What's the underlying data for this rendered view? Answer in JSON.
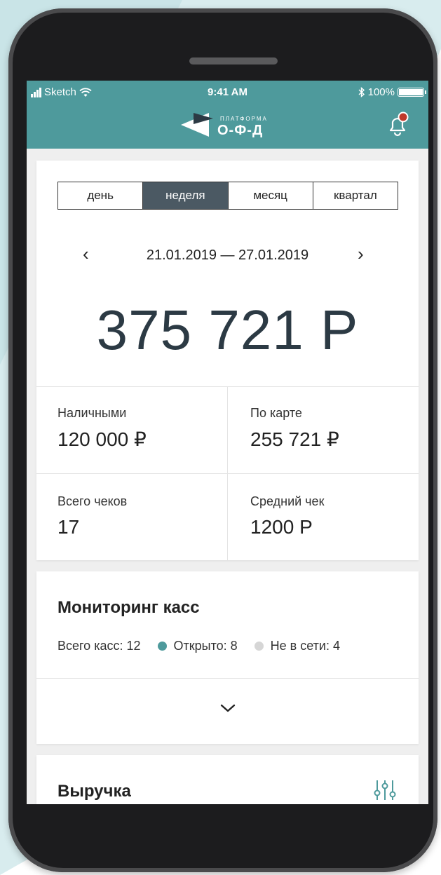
{
  "status_bar": {
    "carrier": "Sketch",
    "time": "9:41 AM",
    "battery": "100%"
  },
  "header": {
    "logo_small": "ПЛАТФОРМА",
    "logo_big": "О-Ф-Д",
    "notification_icon": "bell-icon",
    "notification_dot_color": "#c0392b"
  },
  "periods": {
    "items": [
      "день",
      "неделя",
      "месяц",
      "квартал"
    ],
    "selected": "неделя"
  },
  "date_range": "21.01.2019 — 27.01.2019",
  "total": "375 721 Р",
  "metrics": {
    "cash_label": "Наличными",
    "cash_value": "120 000 ₽",
    "card_label": "По карте",
    "card_value": "255 721 ₽",
    "checks_label": "Всего чеков",
    "checks_value": "17",
    "avg_label": "Средний чек",
    "avg_value": "1200 Р"
  },
  "monitoring": {
    "title": "Мониторинг касс",
    "total": "Всего касс: 12",
    "open": "Открыто: 8",
    "offline": "Не в сети: 4",
    "open_color": "#4e9a9c",
    "offline_color": "#d6d6d6"
  },
  "revenue": {
    "title": "Выручка",
    "filter_icon": "sliders-icon"
  },
  "colors": {
    "header_bg": "#4e9a9c",
    "active_segment": "#4b5963"
  }
}
